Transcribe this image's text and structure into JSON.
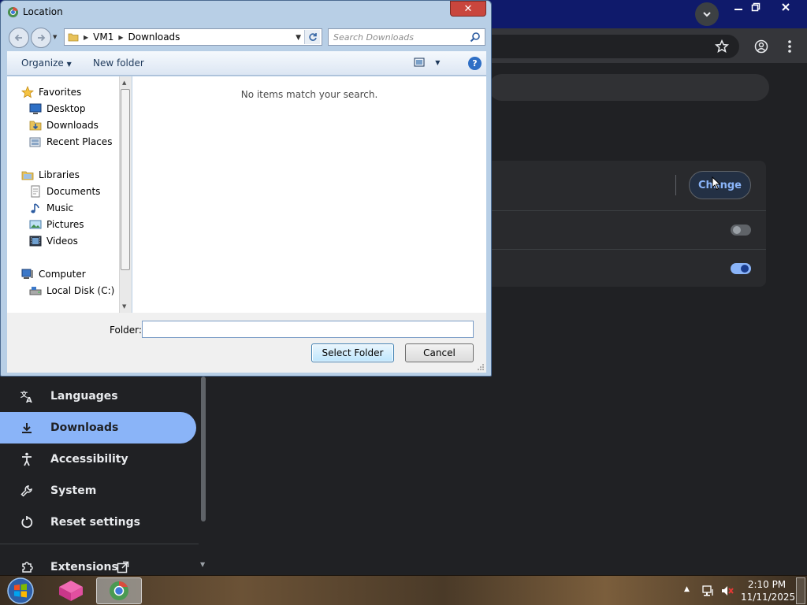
{
  "chrome": {
    "change_label": "Change",
    "sidebar": [
      {
        "label": "Languages",
        "icon": "translate-icon"
      },
      {
        "label": "Downloads",
        "icon": "download-icon"
      },
      {
        "label": "Accessibility",
        "icon": "accessibility-icon"
      },
      {
        "label": "System",
        "icon": "wrench-icon"
      },
      {
        "label": "Reset settings",
        "icon": "reset-icon"
      },
      {
        "label": "Extensions",
        "icon": "extensions-icon"
      }
    ],
    "accent": "#8ab4f8"
  },
  "dialog": {
    "title": "Location",
    "breadcrumb": [
      "VM1",
      "Downloads"
    ],
    "search_placeholder": "Search Downloads",
    "toolbar": {
      "organize": "Organize",
      "new_folder": "New folder"
    },
    "nav": {
      "favorites": "Favorites",
      "desktop": "Desktop",
      "downloads": "Downloads",
      "recent_places": "Recent Places",
      "libraries": "Libraries",
      "documents": "Documents",
      "music": "Music",
      "pictures": "Pictures",
      "videos": "Videos",
      "computer": "Computer",
      "local_disk": "Local Disk (C:)"
    },
    "empty_message": "No items match your search.",
    "folder_label": "Folder:",
    "folder_value": "",
    "select_label": "Select Folder",
    "cancel_label": "Cancel",
    "close_glyph": "✕"
  },
  "taskbar": {
    "time": "2:10 PM",
    "date": "11/11/2025"
  }
}
